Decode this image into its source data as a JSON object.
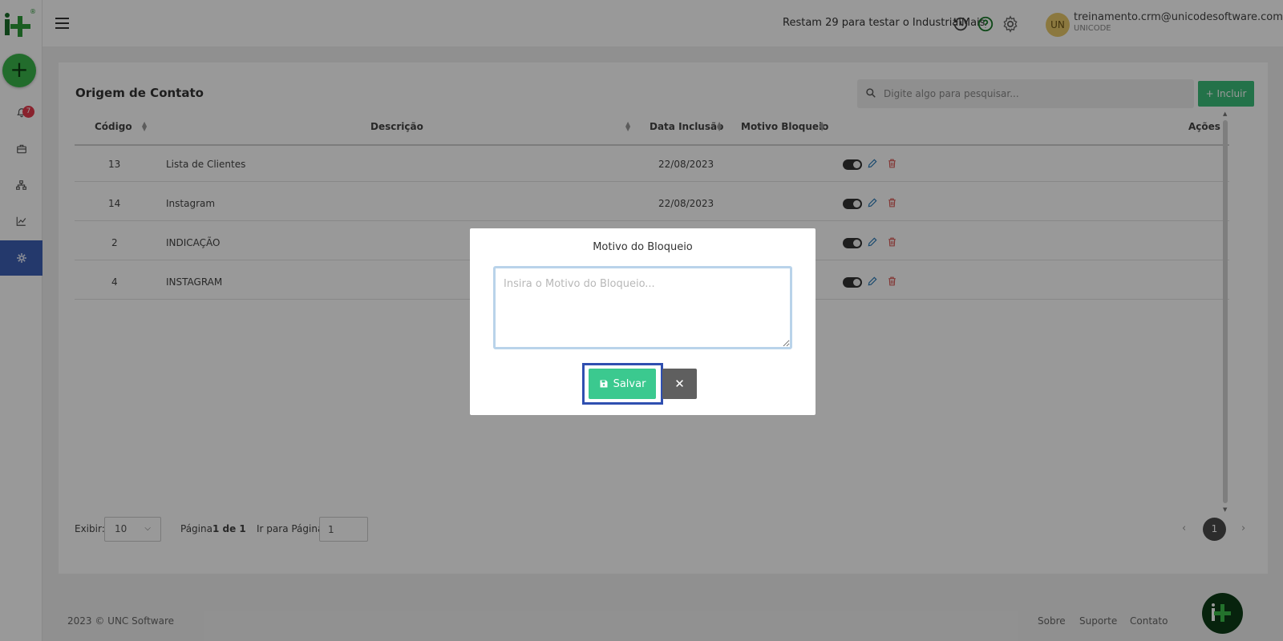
{
  "sidebar": {
    "notifications_count": "7",
    "items": [
      "bell-icon",
      "briefcase-icon",
      "sitemap-icon",
      "chart-line-icon",
      "gear-icon"
    ]
  },
  "topbar": {
    "trial_text": "Restam 29 para testar o IndustrialMais",
    "user_initials": "UN",
    "user_email": "treinamento.crm@unicodesoftware.com.br",
    "user_company": "UNICODE"
  },
  "page": {
    "title": "Origem de Contato",
    "search_placeholder": "Digite algo para pesquisar...",
    "add_button": "+ Incluir"
  },
  "table": {
    "headers": {
      "codigo": "Código",
      "descricao": "Descrição",
      "data": "Data Inclusão",
      "motivo": "Motivo Bloqueio",
      "acoes": "Ações"
    },
    "rows": [
      {
        "codigo": "13",
        "descricao": "Lista de Clientes",
        "data": "22/08/2023"
      },
      {
        "codigo": "14",
        "descricao": "Instagram",
        "data": "22/08/2023"
      },
      {
        "codigo": "2",
        "descricao": "INDICAÇÃO",
        "data": ""
      },
      {
        "codigo": "4",
        "descricao": "INSTAGRAM",
        "data": ""
      }
    ]
  },
  "pagination": {
    "show_label": "Exibir:",
    "show_value": "10",
    "page_label": "Página",
    "page_info": "1 de 1",
    "goto_label": "Ir para Página:",
    "goto_value": "1",
    "current_page": "1"
  },
  "footer": {
    "copyright": "2023 © UNC Software",
    "links": [
      "Sobre",
      "Suporte",
      "Contato"
    ]
  },
  "modal": {
    "title": "Motivo do Bloqueio",
    "placeholder": "Insira o Motivo do Bloqueio...",
    "save_label": "Salvar",
    "close_label": "✕"
  },
  "colors": {
    "brand_green": "#3bbf7a",
    "sidebar_active": "#3c5fb4",
    "badge_red": "#e5394b",
    "focus_blue": "#2f4fb0"
  }
}
